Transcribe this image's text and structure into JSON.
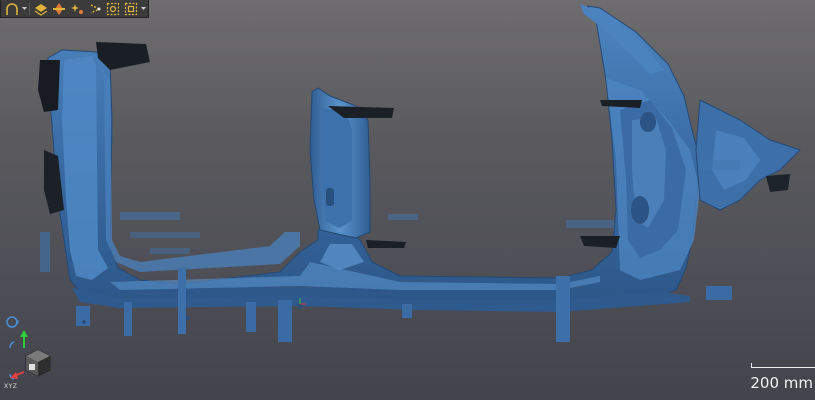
{
  "toolbar": {
    "buttons": [
      {
        "name": "selection-mode-icon",
        "color": "#e0b33a"
      },
      {
        "name": "display-layers-icon",
        "color": "#e0b33a"
      },
      {
        "name": "filter-icon",
        "color": "#e07a3a"
      },
      {
        "name": "sparkle-effects-icon",
        "color": "#e0b33a"
      },
      {
        "name": "dotted-select-icon",
        "color": "#e0b33a"
      },
      {
        "name": "region-select-icon",
        "color": "#e0b33a"
      },
      {
        "name": "fit-view-icon",
        "color": "#e0b33a"
      }
    ]
  },
  "viewport": {
    "model_color": "#3d6fa6",
    "background_top": "#6e6c6e",
    "background_bottom": "#43444b"
  },
  "scale": {
    "label": "200 mm"
  },
  "viewcube": {
    "axis_label": "XYZ"
  }
}
